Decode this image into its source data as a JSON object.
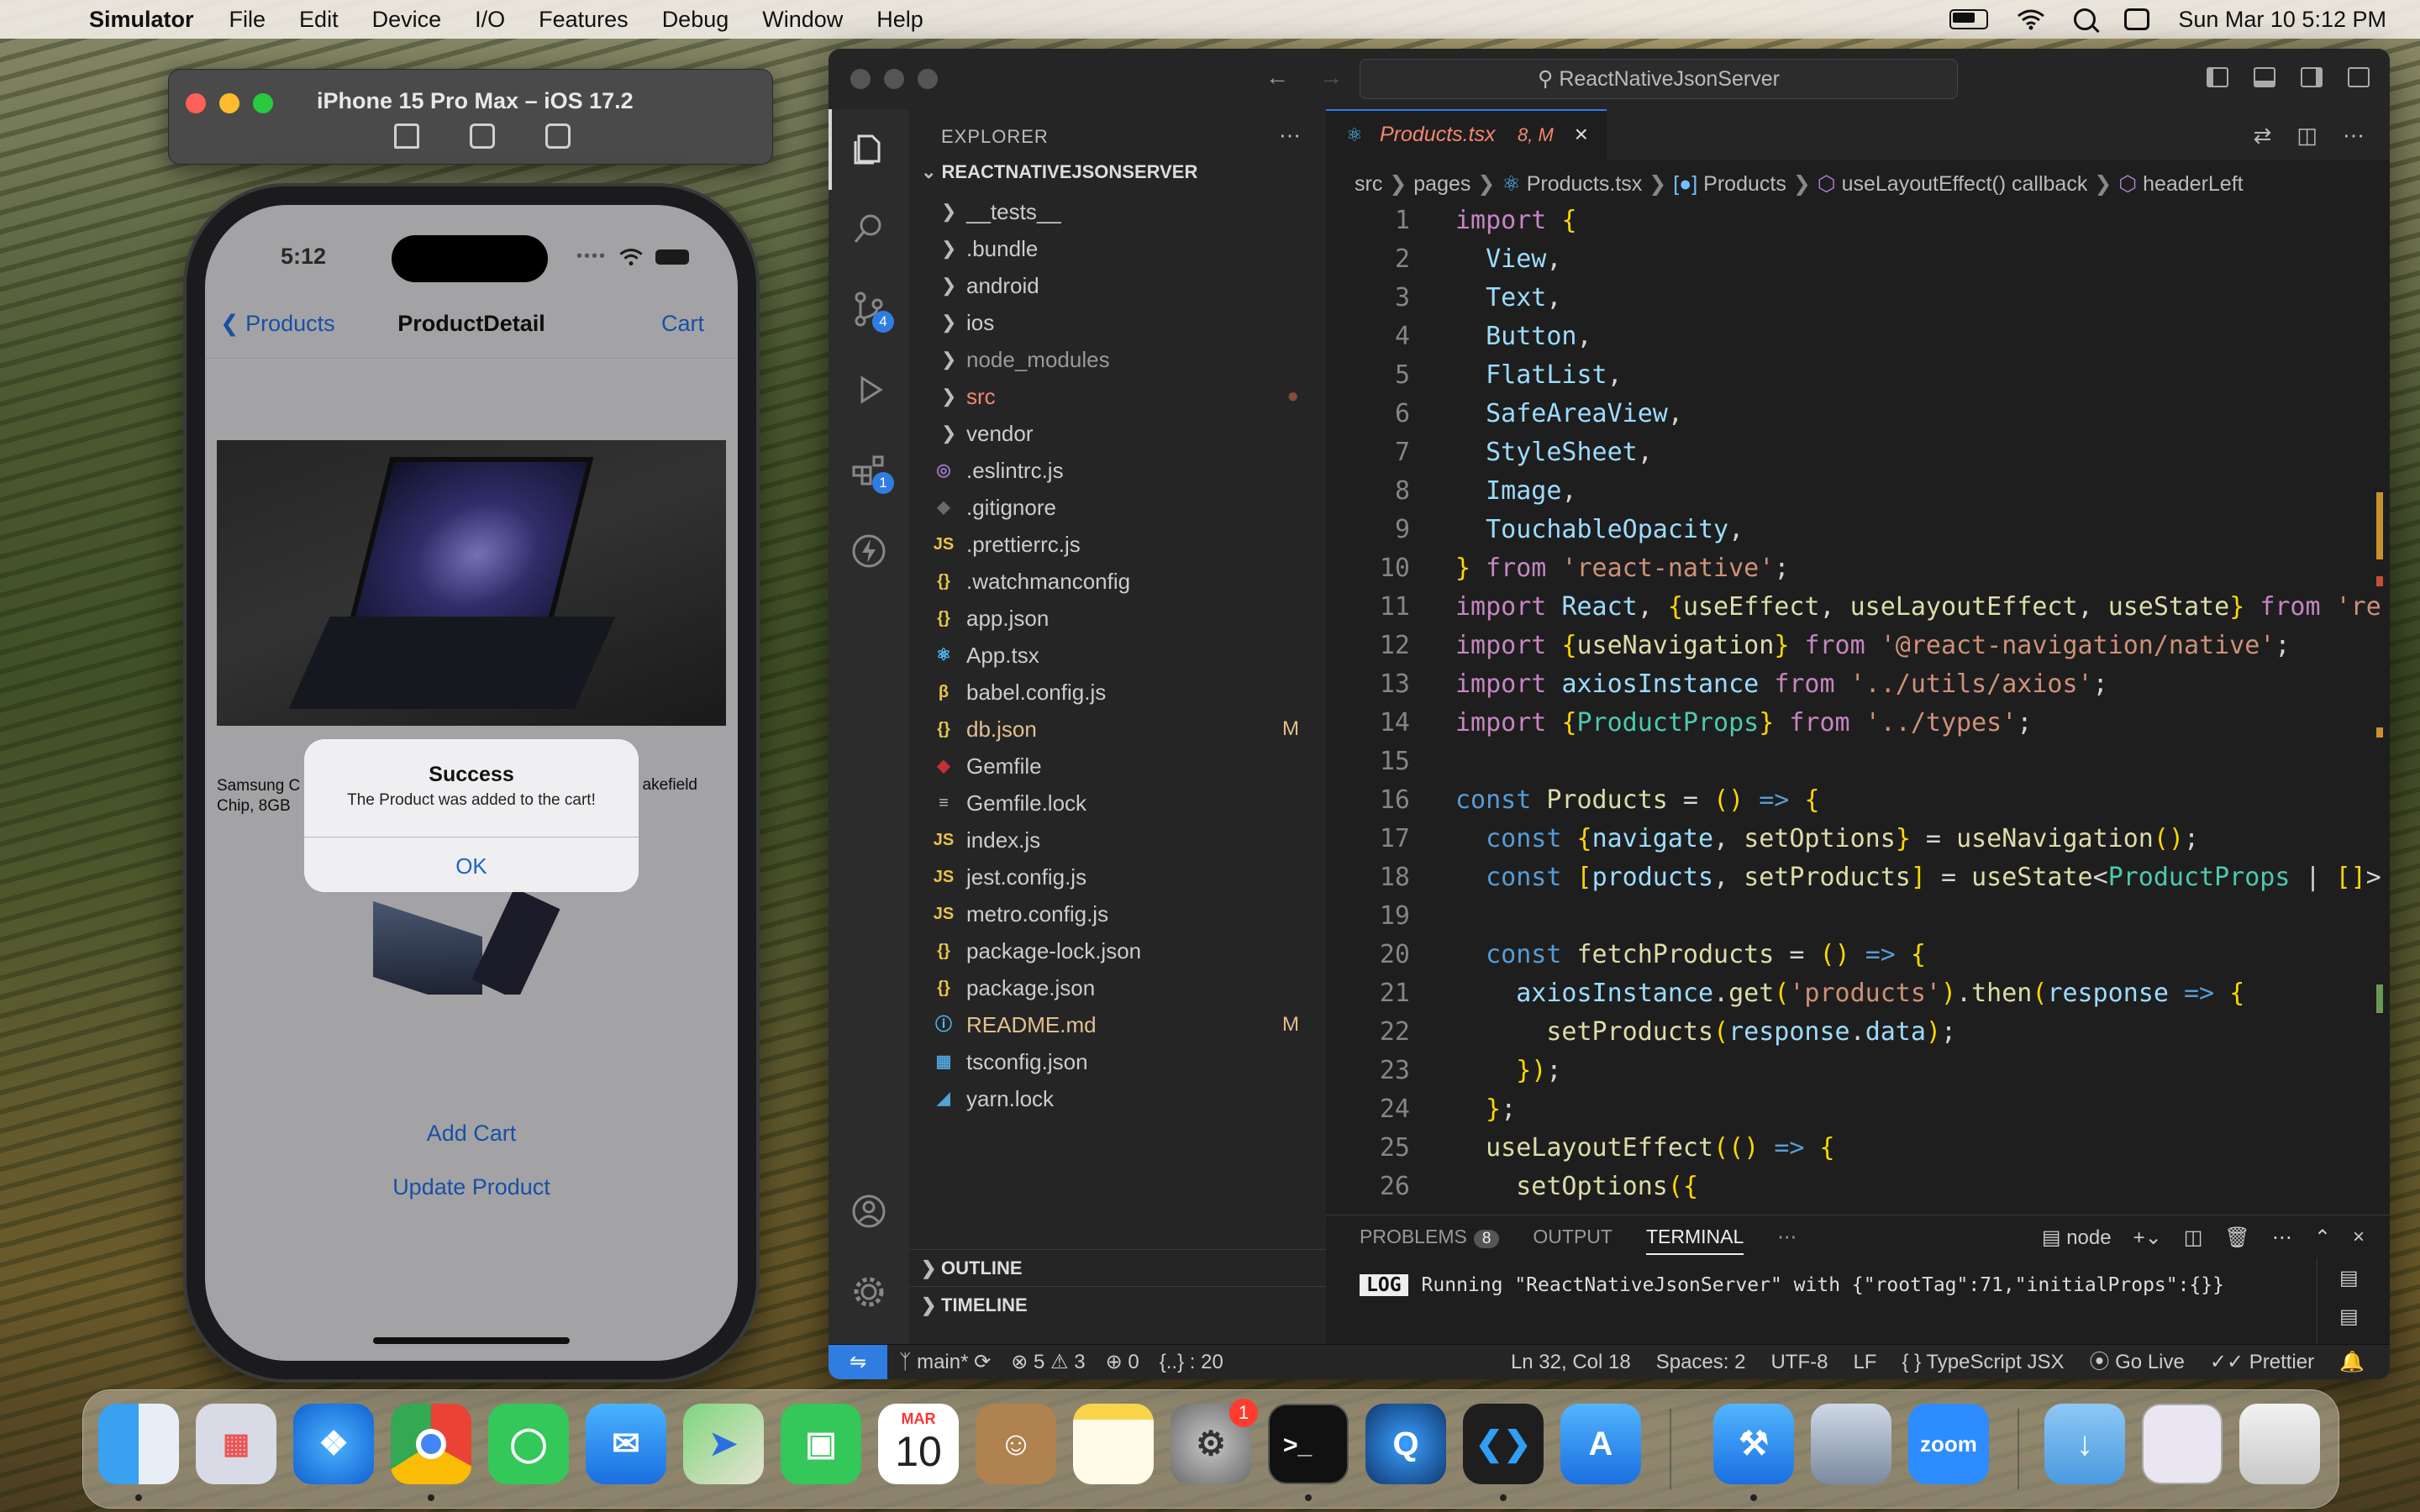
{
  "menubar": {
    "app_name": "Simulator",
    "items": [
      "File",
      "Edit",
      "Device",
      "I/O",
      "Features",
      "Debug",
      "Window",
      "Help"
    ],
    "clock": "Sun Mar 10  5:12 PM"
  },
  "simulator": {
    "window_title": "iPhone 15 Pro Max – iOS 17.2",
    "phone": {
      "time": "5:12",
      "nav_back": "Products",
      "nav_title": "ProductDetail",
      "nav_right": "Cart",
      "product_text_left": "Samsung C",
      "product_text_left2": "Chip, 8GB",
      "product_text_right": "akefield",
      "add_cart": "Add Cart",
      "update_product": "Update Product",
      "alert": {
        "title": "Success",
        "message": "The Product was added to the cart!",
        "ok": "OK"
      }
    }
  },
  "vscode": {
    "search": "ReactNativeJsonServer",
    "explorer": {
      "header": "EXPLORER",
      "root": "REACTNATIVEJSONSERVER",
      "items": [
        {
          "label": "__tests__",
          "type": "folder"
        },
        {
          "label": ".bundle",
          "type": "folder"
        },
        {
          "label": "android",
          "type": "folder"
        },
        {
          "label": "ios",
          "type": "folder"
        },
        {
          "label": "node_modules",
          "type": "folder"
        },
        {
          "label": "src",
          "type": "folder"
        },
        {
          "label": "vendor",
          "type": "folder"
        },
        {
          "label": ".eslintrc.js",
          "type": "file",
          "icon": "◎"
        },
        {
          "label": ".gitignore",
          "type": "file",
          "icon": "◆"
        },
        {
          "label": ".prettierrc.js",
          "type": "file",
          "icon": "JS"
        },
        {
          "label": ".watchmanconfig",
          "type": "file",
          "icon": "{}"
        },
        {
          "label": "app.json",
          "type": "file",
          "icon": "{}"
        },
        {
          "label": "App.tsx",
          "type": "file",
          "icon": "⚛"
        },
        {
          "label": "babel.config.js",
          "type": "file",
          "icon": "β"
        },
        {
          "label": "db.json",
          "type": "file",
          "icon": "{}",
          "mark": "M"
        },
        {
          "label": "Gemfile",
          "type": "file",
          "icon": "◆"
        },
        {
          "label": "Gemfile.lock",
          "type": "file",
          "icon": "≡"
        },
        {
          "label": "index.js",
          "type": "file",
          "icon": "JS"
        },
        {
          "label": "jest.config.js",
          "type": "file",
          "icon": "JS"
        },
        {
          "label": "metro.config.js",
          "type": "file",
          "icon": "JS"
        },
        {
          "label": "package-lock.json",
          "type": "file",
          "icon": "{}"
        },
        {
          "label": "package.json",
          "type": "file",
          "icon": "{}"
        },
        {
          "label": "README.md",
          "type": "file",
          "icon": "ⓘ",
          "mark": "M"
        },
        {
          "label": "tsconfig.json",
          "type": "file",
          "icon": "▦"
        },
        {
          "label": "yarn.lock",
          "type": "file",
          "icon": "◢"
        }
      ],
      "outline": "OUTLINE",
      "timeline": "TIMELINE"
    },
    "tab": {
      "label": "Products.tsx",
      "status": "8, M"
    },
    "breadcrumb": [
      "src",
      "pages",
      "Products.tsx",
      "Products",
      "useLayoutEffect() callback",
      "headerLeft"
    ],
    "code_lines": [
      "import {",
      "  View,",
      "  Text,",
      "  Button,",
      "  FlatList,",
      "  SafeAreaView,",
      "  StyleSheet,",
      "  Image,",
      "  TouchableOpacity,",
      "} from 'react-native';",
      "import React, {useEffect, useLayoutEffect, useState} from 're",
      "import {useNavigation} from '@react-navigation/native';",
      "import axiosInstance from '../utils/axios';",
      "import {ProductProps} from '../types';",
      "",
      "const Products = () => {",
      "  const {navigate, setOptions} = useNavigation();",
      "  const [products, setProducts] = useState<ProductProps | []>",
      "",
      "  const fetchProducts = () => {",
      "    axiosInstance.get('products').then(response => {",
      "      setProducts(response.data);",
      "    });",
      "  };",
      "  useLayoutEffect(() => {",
      "    setOptions({"
    ],
    "panel": {
      "tabs": [
        "PROBLEMS",
        "OUTPUT",
        "TERMINAL"
      ],
      "problems_count": "8",
      "terminal_name": "node",
      "log_tag": "LOG",
      "log_text": "Running \"ReactNativeJsonServer\" with {\"rootTag\":71,\"initialProps\":{}}"
    },
    "statusbar": {
      "branch": "main*",
      "errors": "5",
      "warnings": "3",
      "ports": "0",
      "json": "{..} : 20",
      "position": "Ln 32, Col 18",
      "spaces": "Spaces: 2",
      "encoding": "UTF-8",
      "eol": "LF",
      "language": "TypeScript JSX",
      "golive": "Go Live",
      "prettier": "Prettier"
    },
    "badges": {
      "scm": "4",
      "extensions": "1"
    }
  },
  "dock": {
    "calendar_month": "MAR",
    "calendar_day": "10",
    "settings_badge": "1",
    "zoom_label": "zoom"
  }
}
